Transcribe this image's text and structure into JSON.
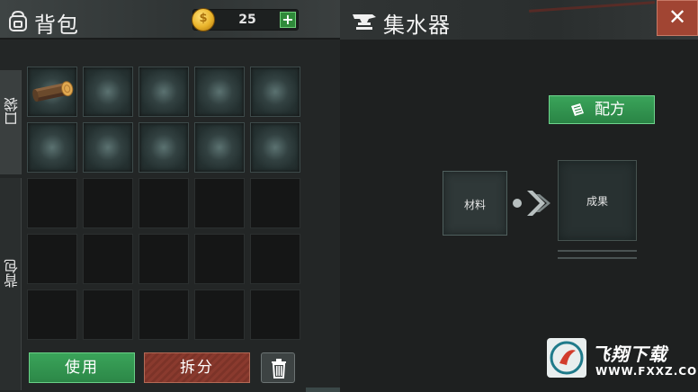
{
  "inventory": {
    "title": "背包",
    "coins": "25",
    "coin_add_label": "+",
    "tabs": [
      {
        "label": "口袋"
      },
      {
        "label": "背包"
      }
    ],
    "pocket_slots": [
      {
        "item": "wood-log"
      },
      {
        "item": ""
      },
      {
        "item": ""
      },
      {
        "item": ""
      },
      {
        "item": ""
      },
      {
        "item": ""
      },
      {
        "item": ""
      },
      {
        "item": ""
      },
      {
        "item": ""
      },
      {
        "item": ""
      }
    ],
    "backpack_slots_count": 15,
    "buttons": {
      "use": "使用",
      "split": "拆分"
    }
  },
  "station": {
    "title": "集水器",
    "close_label": "✕",
    "recipe_button": "配方",
    "material_label": "材料",
    "result_label": "成果"
  },
  "watermark": {
    "title": "飞翔下载",
    "url": "WWW.FXXZ.COM"
  },
  "colors": {
    "accent_green": "#3aa45a",
    "split_red": "#8a3a2e",
    "close_red": "#a14533"
  }
}
